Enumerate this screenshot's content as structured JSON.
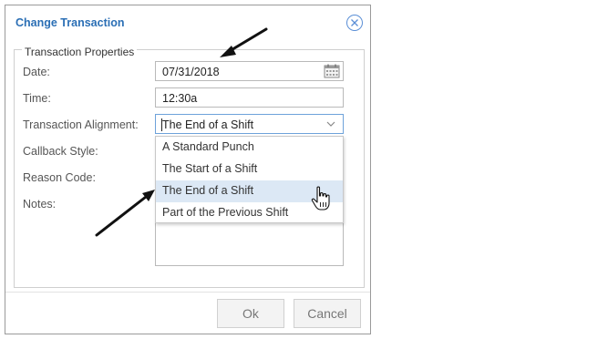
{
  "dialog": {
    "title": "Change Transaction",
    "fieldset_legend": "Transaction Properties"
  },
  "fields": {
    "date_label": "Date:",
    "date_value": "07/31/2018",
    "time_label": "Time:",
    "time_value": "12:30a",
    "alignment_label": "Transaction Alignment:",
    "alignment_value": "The End of a Shift",
    "callback_label": "Callback Style:",
    "reason_label": "Reason Code:",
    "notes_label": "Notes:"
  },
  "dropdown": {
    "options": [
      "A Standard Punch",
      "The Start of a Shift",
      "The End of a Shift",
      "Part of the Previous Shift"
    ],
    "highlighted_option": "The End of a Shift"
  },
  "buttons": {
    "ok": "Ok",
    "cancel": "Cancel"
  },
  "icons": {
    "close": "close-circle-icon",
    "calendar": "calendar-icon",
    "chevron": "chevron-down-icon",
    "pointer": "hand-pointer-icon"
  },
  "colors": {
    "title": "#2b6fb5",
    "highlight": "#dce8f5",
    "focus_border": "#6ea2da"
  }
}
